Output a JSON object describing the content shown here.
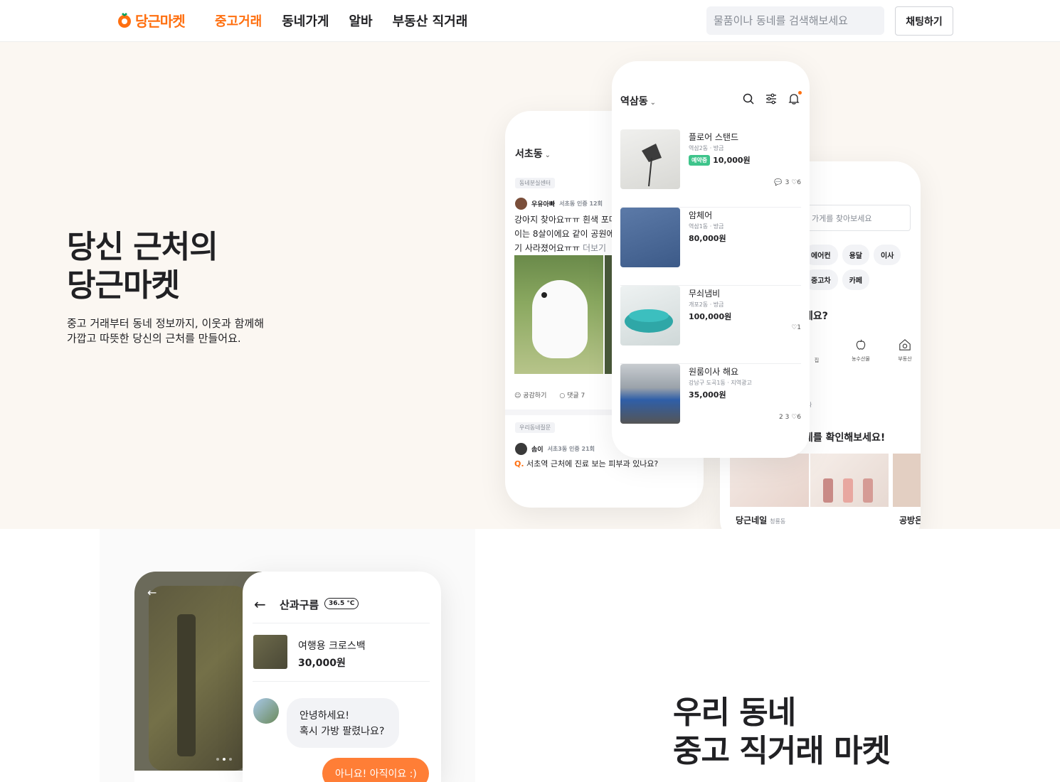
{
  "header": {
    "logo_text": "당근마켓",
    "nav": [
      "중고거래",
      "동네가게",
      "알바",
      "부동산 직거래"
    ],
    "search_placeholder": "물품이나 동네를 검색해보세요",
    "chat_button": "채팅하기"
  },
  "hero": {
    "title_lines": [
      "당신 근처의",
      "당근마켓"
    ],
    "desc_lines": [
      "중고 거래부터 동네 정보까지, 이웃과 함께해",
      "가깝고 따뜻한 당신의 근처를 만들어요."
    ]
  },
  "phone_left": {
    "location": "서초동",
    "tag1": "동네분실센터",
    "user1": "우유아빠",
    "user1_meta": "서초동 인증 12회",
    "post_lines": [
      "강아지 찾아요ㅠㅠ 흰색 포메",
      "이는 8살이에요 같이 공원에",
      "기 사라졌어요ㅠㅠ"
    ],
    "more": "더보기",
    "like_label": "공감하기",
    "comment_label": "댓글 7",
    "tag2": "우리동네질문",
    "user2": "솜이",
    "user2_meta": "서초3동 인증 21회",
    "question_prefix": "Q.",
    "question": "서초역 근처에 진료 보는 피부과 있나요?"
  },
  "phone_mid": {
    "location": "역삼동",
    "items": [
      {
        "name": "플로어 스탠드",
        "meta": "역삼2동 · 방금",
        "badge": "예약중",
        "price": "10,000원",
        "stats": "3 ♡6",
        "comments": "3",
        "likes": "6"
      },
      {
        "name": "암체어",
        "meta": "역삼1동 · 방금",
        "badge": "",
        "price": "80,000원",
        "stats": ""
      },
      {
        "name": "무쇠냄비",
        "meta": "개포2동 · 방금",
        "badge": "",
        "price": "100,000원",
        "stats": "♡1"
      },
      {
        "name": "원룸이사 해요",
        "meta": "강남구 도곡1동 · 지역광고",
        "badge": "",
        "price": "35,000원",
        "stats": "2 3 ♡6"
      }
    ]
  },
  "phone_right": {
    "search_placeholder": "가게를 찾아보세요",
    "chips": [
      "에어컨",
      "용달",
      "이사",
      "중고차",
      "카페"
    ],
    "question": "세요?",
    "cats": [
      "집",
      "농수산물",
      "부동산"
    ],
    "tiny": "사",
    "title": "네를 확인해보세요!",
    "shop1": "당근네일",
    "shop1_loc": "청룡동",
    "shop2": "공방은"
  },
  "section2": {
    "chat_user": "산과구름",
    "temperature": "36.5 °C",
    "product_name": "여행용 크로스백",
    "product_price": "30,000원",
    "bubble_lines": [
      "안녕하세요!",
      "혹시 가방 팔렸나요?"
    ],
    "my_reply": "아니요! 아직이요 :)",
    "title_lines": [
      "우리 동네",
      "중고 직거래 마켓"
    ]
  },
  "colors": {
    "brand": "#ff6f0f",
    "badge_green": "#3ec48b",
    "hero_bg": "#fbf7f2"
  }
}
